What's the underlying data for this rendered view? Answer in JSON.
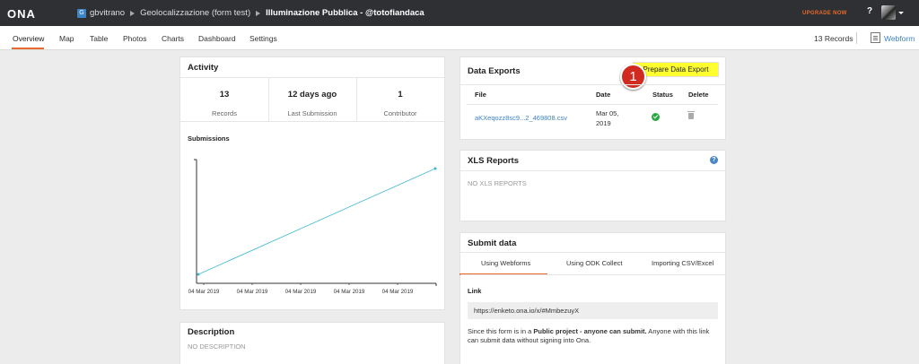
{
  "topbar": {
    "logo": "ONA",
    "user_badge": "G",
    "user": "gbvitrano",
    "project": "Geolocalizzazione (form test)",
    "form": "Illuminazione Pubblica - @totofiandaca",
    "upgrade": "UPGRADE NOW",
    "help": "?"
  },
  "nav": {
    "tabs": [
      "Overview",
      "Map",
      "Table",
      "Photos",
      "Charts",
      "Dashboard",
      "Settings"
    ],
    "records": "13 Records",
    "webform": "Webform"
  },
  "activity": {
    "title": "Activity",
    "stats": [
      {
        "value": "13",
        "label": "Records"
      },
      {
        "value": "12 days ago",
        "label": "Last Submission"
      },
      {
        "value": "1",
        "label": "Contributor"
      }
    ],
    "submissions_title": "Submissions",
    "chart_data": {
      "type": "line",
      "x_tick_labels": [
        "04 Mar 2019",
        "04 Mar 2019",
        "04 Mar 2019",
        "04 Mar 2019",
        "04 Mar 2019"
      ],
      "series": [
        {
          "x": [
            0,
            1
          ],
          "y": [
            1,
            13
          ]
        }
      ],
      "line_color": "#3fb9d1",
      "grid": false
    }
  },
  "description": {
    "title": "Description",
    "text": "NO DESCRIPTION"
  },
  "exports": {
    "title": "Data Exports",
    "prepare_label": "Prepare Data Export",
    "annotation": "1",
    "columns": [
      "File",
      "Date",
      "Status",
      "Delete"
    ],
    "rows": [
      {
        "file": "aKXeqozz8sc9...2_469808.csv",
        "date_line1": "Mar 05,",
        "date_line2": "2019"
      }
    ]
  },
  "xls": {
    "title": "XLS Reports",
    "empty": "NO XLS REPORTS",
    "info": "?"
  },
  "submit": {
    "title": "Submit data",
    "tabs": [
      "Using Webforms",
      "Using ODK Collect",
      "Importing CSV/Excel"
    ],
    "link_label": "Link",
    "link": "https://enketo.ona.io/x/#MmbezuyX",
    "text_before": "Since this form is in a ",
    "text_bold": "Public project - anyone can submit.",
    "text_after": " Anyone with this link can submit data without signing into Ona."
  },
  "colors": {
    "accent": "#e76a2c",
    "link": "#3d83c6",
    "topbar": "#2f3034",
    "highlight": "#ffff30",
    "annotation": "#d12a21"
  }
}
